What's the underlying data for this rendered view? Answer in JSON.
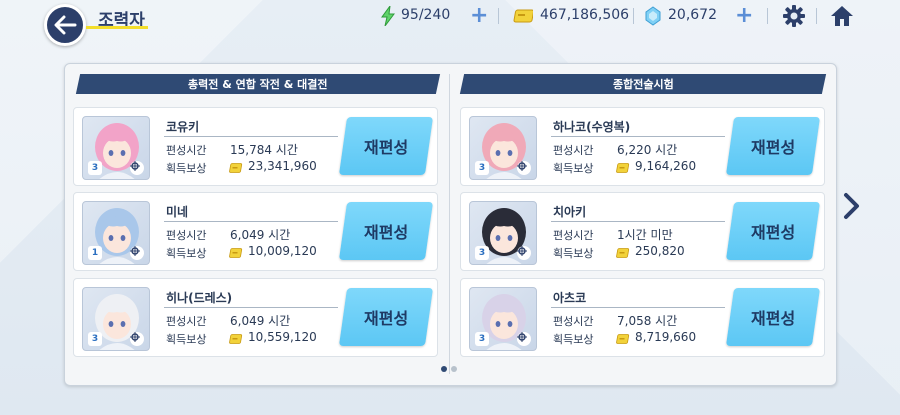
{
  "header": {
    "title": "조력자",
    "ap": "95/240",
    "credits": "467,186,506",
    "gems": "20,672"
  },
  "columns": {
    "left": "총력전 & 연합 작전 & 대결전",
    "right": "종합전술시험"
  },
  "labels": {
    "time": "편성시간",
    "reward": "획득보상",
    "reform": "재편성"
  },
  "cards": [
    {
      "name": "코유키",
      "time": "15,784 시간",
      "reward": "23,341,960",
      "rank": "3",
      "hair": "#f2a3c8"
    },
    {
      "name": "미네",
      "time": "6,049 시간",
      "reward": "10,009,120",
      "rank": "1",
      "hair": "#a9c7ea"
    },
    {
      "name": "히나(드레스)",
      "time": "6,049 시간",
      "reward": "10,559,120",
      "rank": "3",
      "hair": "#eef0f4"
    },
    {
      "name": "하나코(수영복)",
      "time": "6,220 시간",
      "reward": "9,164,260",
      "rank": "3",
      "hair": "#f0a9b8"
    },
    {
      "name": "치아키",
      "time": "1시간 미만",
      "reward": "250,820",
      "rank": "3",
      "hair": "#2a2c38"
    },
    {
      "name": "아츠코",
      "time": "7,058 시간",
      "reward": "8,719,660",
      "rank": "3",
      "hair": "#d8d2e8"
    }
  ],
  "pagination": {
    "current": 1,
    "total": 2
  },
  "icons": {
    "back": "arrow-left-icon",
    "ap": "lightning-icon",
    "credit": "coin-icon",
    "gem": "gem-icon",
    "settings": "gear-icon",
    "home": "home-icon",
    "next": "chevron-right-icon"
  },
  "colors": {
    "accent": "#2f4a74",
    "button": "#6ccff7",
    "title_underline": "#f3de2c"
  }
}
